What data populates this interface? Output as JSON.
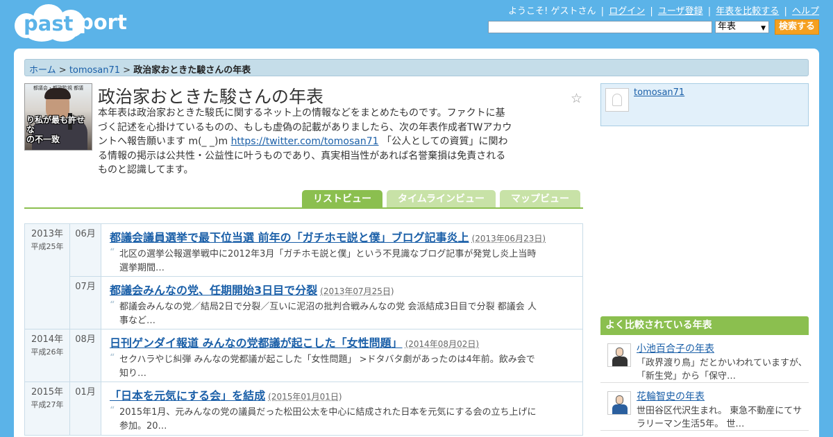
{
  "header": {
    "logo_text": "pastport",
    "welcome": "ようこそ! ゲストさん",
    "links": [
      "ログイン",
      "ユーザ登録",
      "年表を比較する",
      "ヘルプ"
    ],
    "search_value": "",
    "search_type": "年表",
    "search_button": "検索する"
  },
  "breadcrumb": {
    "home": "ホーム",
    "user": "tomosan71",
    "current": "政治家おときた駿さんの年表",
    "separator": ">"
  },
  "profile": {
    "photo_caption": "り私が最も許せな\nの不一致",
    "photo_topcap": "都議会・都政監視 都議"
  },
  "page": {
    "title": "政治家おときた駿さんの年表",
    "description_before": "本年表は政治家おときた駿氏に関するネット上の情報などをまとめたものです。ファクトに基づく記述を心掛けているものの、もしも虚偽の記載がありましたら、次の年表作成者TWアカウントへ報告願います m(_ _)m ",
    "description_link": "https://twitter.com/tomosan71",
    "description_after": " 「公人としての資質」に関わる情報の掲示は公共性・公益性に叶うものであり、真実相当性があれば名誉棄損は免責されるものと認識してます。"
  },
  "tabs": [
    {
      "label": "リストビュー",
      "active": true
    },
    {
      "label": "タイムラインビュー",
      "active": false
    },
    {
      "label": "マップビュー",
      "active": false
    }
  ],
  "timeline": [
    {
      "year": "2013年",
      "era": "平成25年",
      "months": [
        {
          "month": "06月",
          "title": "都議会議員選挙で最下位当選 前年の「ガチホモ説と僕」ブログ記事炎上",
          "date": "(2013年06月23日)",
          "desc": "北区の選挙公報選挙戦中に2012年3月「ガチホモ説と僕」という不見識なブログ記事が発覚し炎上当時選挙期間…"
        },
        {
          "month": "07月",
          "title": "都議会みんなの党、任期開始3日目で分裂",
          "date": "(2013年07月25日)",
          "desc": "都議会みんなの党／結局2日で分裂／互いに泥沼の批判合戦みんなの党 会派結成3日目で分裂 都議会 人事など…"
        }
      ]
    },
    {
      "year": "2014年",
      "era": "平成26年",
      "months": [
        {
          "month": "08月",
          "title": "日刊ゲンダイ報道 みんなの党都議が起こした「女性問題」",
          "date": "(2014年08月02日)",
          "desc": "セクハラやじ糾弾 みんなの党都議が起こした「女性問題」 >ドタバタ劇があったのは4年前。飲み会で知り…"
        }
      ]
    },
    {
      "year": "2015年",
      "era": "平成27年",
      "months": [
        {
          "month": "01月",
          "title": "「日本を元気にする会」を結成",
          "date": "(2015年01月01日)",
          "desc": "2015年1月、元みんなの党の議員だった松田公太を中心に結成された日本を元気にする会の立ち上げに参加。20…"
        }
      ]
    }
  ],
  "sidebar": {
    "user_name": "tomosan71",
    "popular_heading": "よく比較されている年表",
    "popular": [
      {
        "title": "小池百合子の年表",
        "desc": "「政界渡り鳥」だとかいわれていますが、「新生党」から「保守…"
      },
      {
        "title": "花輪智史の年表",
        "desc": "世田谷区代沢生まれ。 東急不動産にてサラリーマン生活5年。 世…"
      }
    ]
  },
  "icons": {
    "star": "star-icon",
    "quote": "quote-icon",
    "dropdown": "chevron-down-icon"
  },
  "colors": {
    "background": "#5bb3e8",
    "accent_green": "#8bbf4f",
    "search_button": "#f5a020",
    "link": "#1a5fa8"
  }
}
